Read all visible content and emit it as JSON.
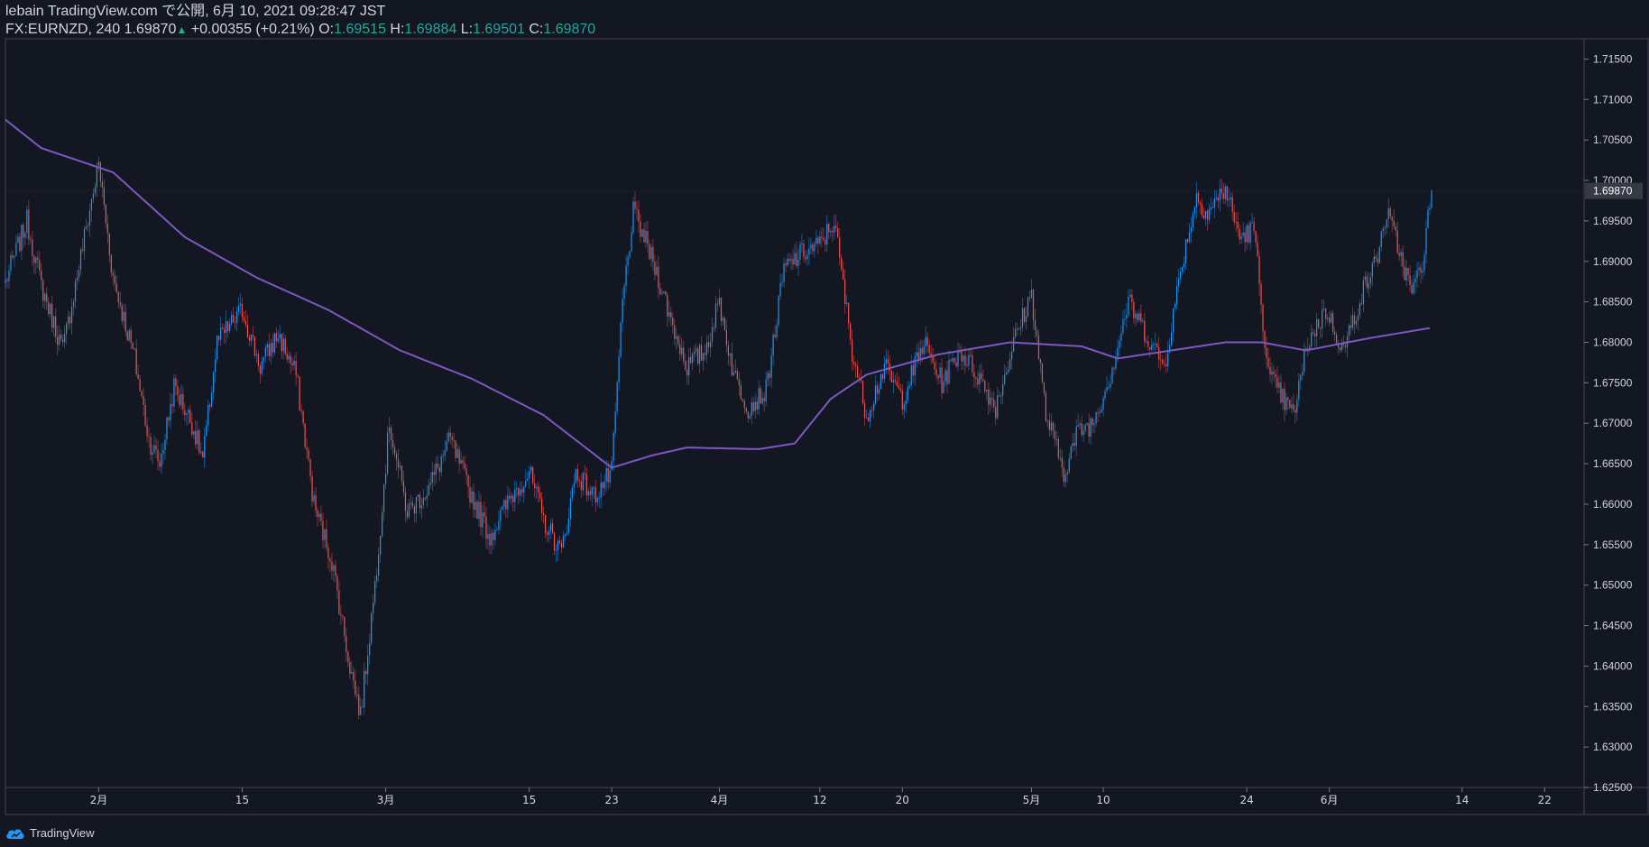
{
  "header": {
    "line1": "lebain TradingView.com で公開, 6月 10, 2021 09:28:47 JST",
    "symbol": "FX:EURNZD, 240",
    "last": "1.69870",
    "change": "+0.00355 (+0.21%)",
    "o_label": "O:",
    "o_val": "1.69515",
    "h_label": "H:",
    "h_val": "1.69884",
    "l_label": "L:",
    "l_val": "1.69501",
    "c_label": "C:",
    "c_val": "1.69870"
  },
  "footer": {
    "brand": "TradingView"
  },
  "colors": {
    "background": "#131722",
    "up": "#2196f3",
    "down": "#ef5350",
    "ma": "#7e57c2",
    "text": "#d1d4dc",
    "ohlc": "#26a69a",
    "price_label_bg": "#363a45"
  },
  "chart_data": {
    "type": "candlestick",
    "ylim": [
      1.625,
      1.7175
    ],
    "yticks": [
      "1.71500",
      "1.71000",
      "1.70500",
      "1.70000",
      "1.69500",
      "1.69000",
      "1.68500",
      "1.68000",
      "1.67500",
      "1.67000",
      "1.66500",
      "1.66000",
      "1.65500",
      "1.65000",
      "1.64500",
      "1.64000",
      "1.63500",
      "1.63000",
      "1.62500"
    ],
    "current_price": "1.69870",
    "xticks": [
      "2月",
      "15",
      "3月",
      "15",
      "23",
      "4月",
      "12",
      "20",
      "5月",
      "10",
      "24",
      "6月",
      "14",
      "22"
    ],
    "xtick_index": [
      52,
      132,
      212,
      292,
      338,
      398,
      454,
      500,
      572,
      612,
      692,
      738,
      812,
      858
    ],
    "n_slots": 880,
    "close_index": 795,
    "anchors": [
      [
        0,
        1.6875
      ],
      [
        12,
        1.695
      ],
      [
        20,
        1.687
      ],
      [
        32,
        1.679
      ],
      [
        44,
        1.693
      ],
      [
        52,
        1.702
      ],
      [
        60,
        1.688
      ],
      [
        72,
        1.678
      ],
      [
        80,
        1.668
      ],
      [
        86,
        1.665
      ],
      [
        94,
        1.6745
      ],
      [
        104,
        1.67
      ],
      [
        110,
        1.6655
      ],
      [
        118,
        1.68
      ],
      [
        132,
        1.684
      ],
      [
        142,
        1.677
      ],
      [
        152,
        1.681
      ],
      [
        162,
        1.676
      ],
      [
        172,
        1.66
      ],
      [
        182,
        1.653
      ],
      [
        192,
        1.64
      ],
      [
        198,
        1.634
      ],
      [
        206,
        1.65
      ],
      [
        214,
        1.67
      ],
      [
        224,
        1.659
      ],
      [
        236,
        1.662
      ],
      [
        248,
        1.668
      ],
      [
        258,
        1.662
      ],
      [
        270,
        1.656
      ],
      [
        282,
        1.661
      ],
      [
        292,
        1.664
      ],
      [
        300,
        1.658
      ],
      [
        310,
        1.654
      ],
      [
        318,
        1.664
      ],
      [
        328,
        1.661
      ],
      [
        338,
        1.664
      ],
      [
        344,
        1.685
      ],
      [
        350,
        1.696
      ],
      [
        356,
        1.693
      ],
      [
        364,
        1.688
      ],
      [
        372,
        1.682
      ],
      [
        380,
        1.677
      ],
      [
        390,
        1.679
      ],
      [
        398,
        1.685
      ],
      [
        406,
        1.676
      ],
      [
        414,
        1.672
      ],
      [
        424,
        1.674
      ],
      [
        434,
        1.689
      ],
      [
        444,
        1.691
      ],
      [
        454,
        1.692
      ],
      [
        462,
        1.695
      ],
      [
        472,
        1.679
      ],
      [
        480,
        1.671
      ],
      [
        490,
        1.677
      ],
      [
        500,
        1.673
      ],
      [
        512,
        1.68
      ],
      [
        522,
        1.675
      ],
      [
        532,
        1.679
      ],
      [
        542,
        1.676
      ],
      [
        552,
        1.672
      ],
      [
        562,
        1.68
      ],
      [
        572,
        1.686
      ],
      [
        580,
        1.671
      ],
      [
        590,
        1.664
      ],
      [
        598,
        1.669
      ],
      [
        606,
        1.67
      ],
      [
        616,
        1.676
      ],
      [
        626,
        1.685
      ],
      [
        636,
        1.681
      ],
      [
        646,
        1.677
      ],
      [
        656,
        1.69
      ],
      [
        664,
        1.698
      ],
      [
        670,
        1.696
      ],
      [
        680,
        1.699
      ],
      [
        688,
        1.693
      ],
      [
        696,
        1.694
      ],
      [
        704,
        1.676
      ],
      [
        712,
        1.673
      ],
      [
        718,
        1.671
      ],
      [
        726,
        1.68
      ],
      [
        736,
        1.684
      ],
      [
        746,
        1.679
      ],
      [
        756,
        1.686
      ],
      [
        764,
        1.69
      ],
      [
        770,
        1.696
      ],
      [
        776,
        1.692
      ],
      [
        784,
        1.686
      ],
      [
        790,
        1.69
      ],
      [
        795,
        1.6987
      ]
    ],
    "ma_anchors": [
      [
        0,
        1.7075
      ],
      [
        20,
        1.704
      ],
      [
        60,
        1.701
      ],
      [
        100,
        1.693
      ],
      [
        140,
        1.688
      ],
      [
        180,
        1.684
      ],
      [
        220,
        1.679
      ],
      [
        260,
        1.6755
      ],
      [
        300,
        1.671
      ],
      [
        338,
        1.6645
      ],
      [
        360,
        1.666
      ],
      [
        380,
        1.667
      ],
      [
        420,
        1.6668
      ],
      [
        440,
        1.6675
      ],
      [
        460,
        1.673
      ],
      [
        480,
        1.676
      ],
      [
        520,
        1.6785
      ],
      [
        560,
        1.68
      ],
      [
        600,
        1.6795
      ],
      [
        620,
        1.678
      ],
      [
        650,
        1.679
      ],
      [
        680,
        1.68
      ],
      [
        700,
        1.68
      ],
      [
        725,
        1.679
      ],
      [
        760,
        1.6805
      ],
      [
        795,
        1.6818
      ]
    ]
  }
}
